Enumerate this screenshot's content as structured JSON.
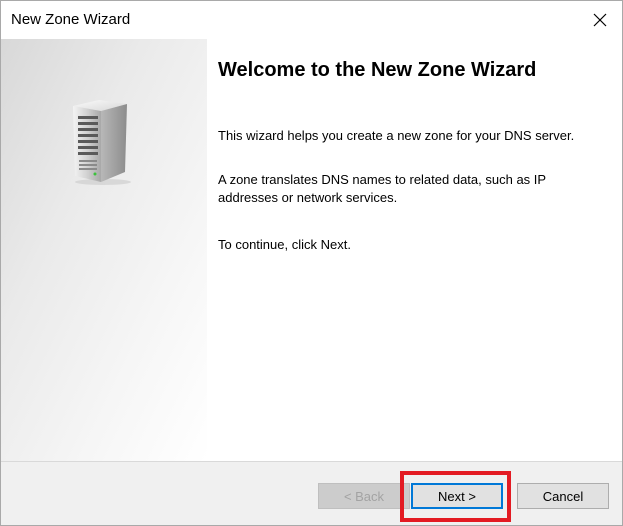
{
  "window": {
    "title": "New Zone Wizard"
  },
  "icons": {
    "close": "close-icon",
    "server": "server-icon"
  },
  "main": {
    "heading": "Welcome to the New Zone Wizard",
    "paragraph1": "This wizard helps you create a new zone for your DNS server.",
    "paragraph2": "A zone translates DNS names to related data, such as IP addresses or network services.",
    "paragraph3": "To continue, click Next."
  },
  "footer": {
    "back_label": "< Back",
    "back_enabled": false,
    "next_label": "Next >",
    "cancel_label": "Cancel"
  },
  "colors": {
    "highlight": "#e31b23",
    "focus": "#0078d7"
  }
}
